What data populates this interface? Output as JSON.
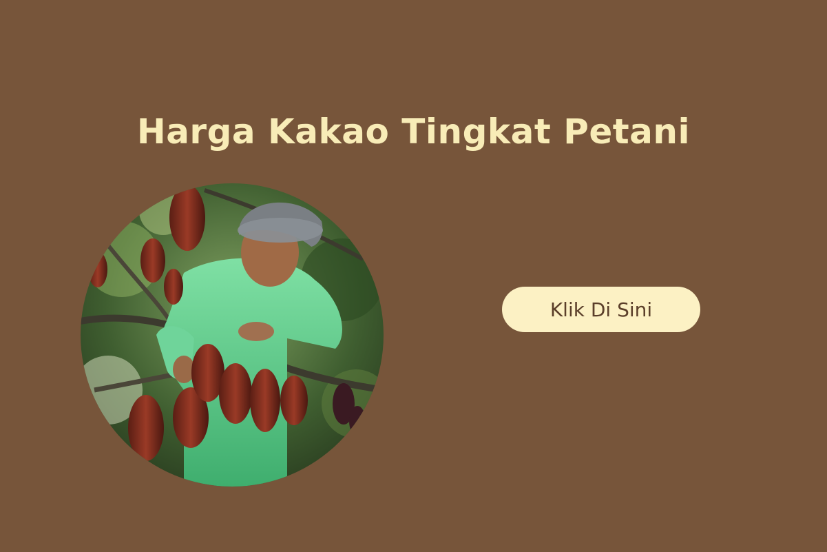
{
  "banner": {
    "title": "Harga Kakao Tingkat Petani",
    "cta_label": "Klik Di Sini",
    "photo": "cocoa-farmer-photo"
  },
  "colors": {
    "background": "#77553a",
    "title": "#f8ecb7",
    "button_bg": "#fcf1c4",
    "button_text": "#5b3f2a"
  }
}
